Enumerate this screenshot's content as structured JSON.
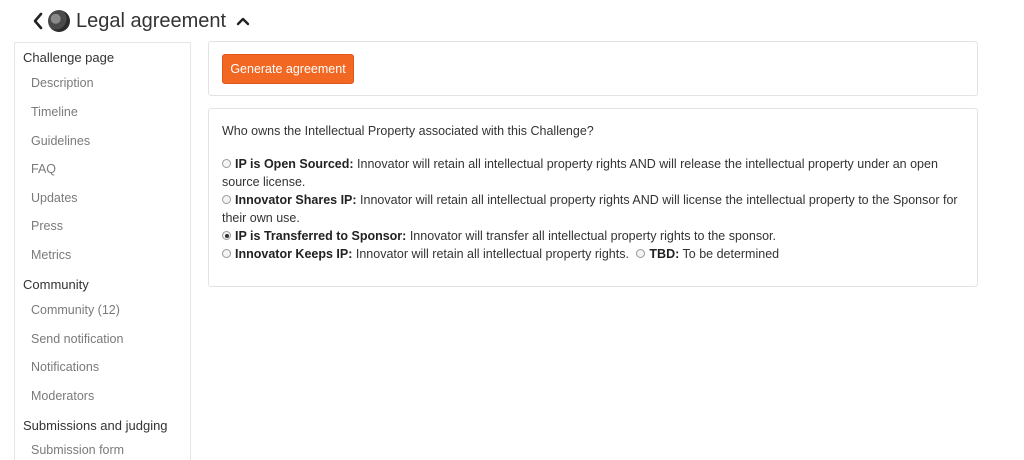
{
  "header": {
    "title": "Legal agreement"
  },
  "sidebar": {
    "sections": [
      {
        "title": "Challenge page",
        "items": [
          "Description",
          "Timeline",
          "Guidelines",
          "FAQ",
          "Updates",
          "Press",
          "Metrics"
        ]
      },
      {
        "title": "Community",
        "items": [
          "Community (12)",
          "Send notification",
          "Notifications",
          "Moderators"
        ]
      },
      {
        "title": "Submissions and judging",
        "items": [
          "Submission form"
        ]
      }
    ]
  },
  "main": {
    "generate_button": "Generate agreement",
    "question": "Who owns the Intellectual Property associated with this Challenge?",
    "options": [
      {
        "label": "IP is Open Sourced:",
        "text": "Innovator will retain all intellectual property rights AND will release the intellectual property under an open source license.",
        "checked": false
      },
      {
        "label": "Innovator Shares IP:",
        "text": "Innovator will retain all intellectual property rights AND will license the intellectual property to the Sponsor for their own use.",
        "checked": false
      },
      {
        "label": "IP is Transferred to Sponsor:",
        "text": "Innovator will transfer all intellectual property rights to the sponsor.",
        "checked": true
      },
      {
        "label": "Innovator Keeps IP:",
        "text": "Innovator will retain all intellectual property rights.",
        "checked": false
      },
      {
        "label": "TBD:",
        "text": "To be determined",
        "checked": false
      }
    ]
  },
  "colors": {
    "accent": "#f26722"
  }
}
